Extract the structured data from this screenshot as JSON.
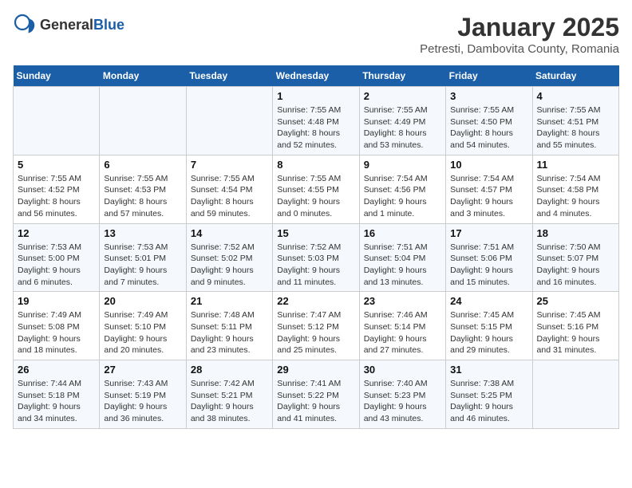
{
  "logo": {
    "general": "General",
    "blue": "Blue"
  },
  "title": "January 2025",
  "subtitle": "Petresti, Dambovita County, Romania",
  "days_of_week": [
    "Sunday",
    "Monday",
    "Tuesday",
    "Wednesday",
    "Thursday",
    "Friday",
    "Saturday"
  ],
  "weeks": [
    [
      {
        "day": "",
        "info": ""
      },
      {
        "day": "",
        "info": ""
      },
      {
        "day": "",
        "info": ""
      },
      {
        "day": "1",
        "info": "Sunrise: 7:55 AM\nSunset: 4:48 PM\nDaylight: 8 hours and 52 minutes."
      },
      {
        "day": "2",
        "info": "Sunrise: 7:55 AM\nSunset: 4:49 PM\nDaylight: 8 hours and 53 minutes."
      },
      {
        "day": "3",
        "info": "Sunrise: 7:55 AM\nSunset: 4:50 PM\nDaylight: 8 hours and 54 minutes."
      },
      {
        "day": "4",
        "info": "Sunrise: 7:55 AM\nSunset: 4:51 PM\nDaylight: 8 hours and 55 minutes."
      }
    ],
    [
      {
        "day": "5",
        "info": "Sunrise: 7:55 AM\nSunset: 4:52 PM\nDaylight: 8 hours and 56 minutes."
      },
      {
        "day": "6",
        "info": "Sunrise: 7:55 AM\nSunset: 4:53 PM\nDaylight: 8 hours and 57 minutes."
      },
      {
        "day": "7",
        "info": "Sunrise: 7:55 AM\nSunset: 4:54 PM\nDaylight: 8 hours and 59 minutes."
      },
      {
        "day": "8",
        "info": "Sunrise: 7:55 AM\nSunset: 4:55 PM\nDaylight: 9 hours and 0 minutes."
      },
      {
        "day": "9",
        "info": "Sunrise: 7:54 AM\nSunset: 4:56 PM\nDaylight: 9 hours and 1 minute."
      },
      {
        "day": "10",
        "info": "Sunrise: 7:54 AM\nSunset: 4:57 PM\nDaylight: 9 hours and 3 minutes."
      },
      {
        "day": "11",
        "info": "Sunrise: 7:54 AM\nSunset: 4:58 PM\nDaylight: 9 hours and 4 minutes."
      }
    ],
    [
      {
        "day": "12",
        "info": "Sunrise: 7:53 AM\nSunset: 5:00 PM\nDaylight: 9 hours and 6 minutes."
      },
      {
        "day": "13",
        "info": "Sunrise: 7:53 AM\nSunset: 5:01 PM\nDaylight: 9 hours and 7 minutes."
      },
      {
        "day": "14",
        "info": "Sunrise: 7:52 AM\nSunset: 5:02 PM\nDaylight: 9 hours and 9 minutes."
      },
      {
        "day": "15",
        "info": "Sunrise: 7:52 AM\nSunset: 5:03 PM\nDaylight: 9 hours and 11 minutes."
      },
      {
        "day": "16",
        "info": "Sunrise: 7:51 AM\nSunset: 5:04 PM\nDaylight: 9 hours and 13 minutes."
      },
      {
        "day": "17",
        "info": "Sunrise: 7:51 AM\nSunset: 5:06 PM\nDaylight: 9 hours and 15 minutes."
      },
      {
        "day": "18",
        "info": "Sunrise: 7:50 AM\nSunset: 5:07 PM\nDaylight: 9 hours and 16 minutes."
      }
    ],
    [
      {
        "day": "19",
        "info": "Sunrise: 7:49 AM\nSunset: 5:08 PM\nDaylight: 9 hours and 18 minutes."
      },
      {
        "day": "20",
        "info": "Sunrise: 7:49 AM\nSunset: 5:10 PM\nDaylight: 9 hours and 20 minutes."
      },
      {
        "day": "21",
        "info": "Sunrise: 7:48 AM\nSunset: 5:11 PM\nDaylight: 9 hours and 23 minutes."
      },
      {
        "day": "22",
        "info": "Sunrise: 7:47 AM\nSunset: 5:12 PM\nDaylight: 9 hours and 25 minutes."
      },
      {
        "day": "23",
        "info": "Sunrise: 7:46 AM\nSunset: 5:14 PM\nDaylight: 9 hours and 27 minutes."
      },
      {
        "day": "24",
        "info": "Sunrise: 7:45 AM\nSunset: 5:15 PM\nDaylight: 9 hours and 29 minutes."
      },
      {
        "day": "25",
        "info": "Sunrise: 7:45 AM\nSunset: 5:16 PM\nDaylight: 9 hours and 31 minutes."
      }
    ],
    [
      {
        "day": "26",
        "info": "Sunrise: 7:44 AM\nSunset: 5:18 PM\nDaylight: 9 hours and 34 minutes."
      },
      {
        "day": "27",
        "info": "Sunrise: 7:43 AM\nSunset: 5:19 PM\nDaylight: 9 hours and 36 minutes."
      },
      {
        "day": "28",
        "info": "Sunrise: 7:42 AM\nSunset: 5:21 PM\nDaylight: 9 hours and 38 minutes."
      },
      {
        "day": "29",
        "info": "Sunrise: 7:41 AM\nSunset: 5:22 PM\nDaylight: 9 hours and 41 minutes."
      },
      {
        "day": "30",
        "info": "Sunrise: 7:40 AM\nSunset: 5:23 PM\nDaylight: 9 hours and 43 minutes."
      },
      {
        "day": "31",
        "info": "Sunrise: 7:38 AM\nSunset: 5:25 PM\nDaylight: 9 hours and 46 minutes."
      },
      {
        "day": "",
        "info": ""
      }
    ]
  ]
}
